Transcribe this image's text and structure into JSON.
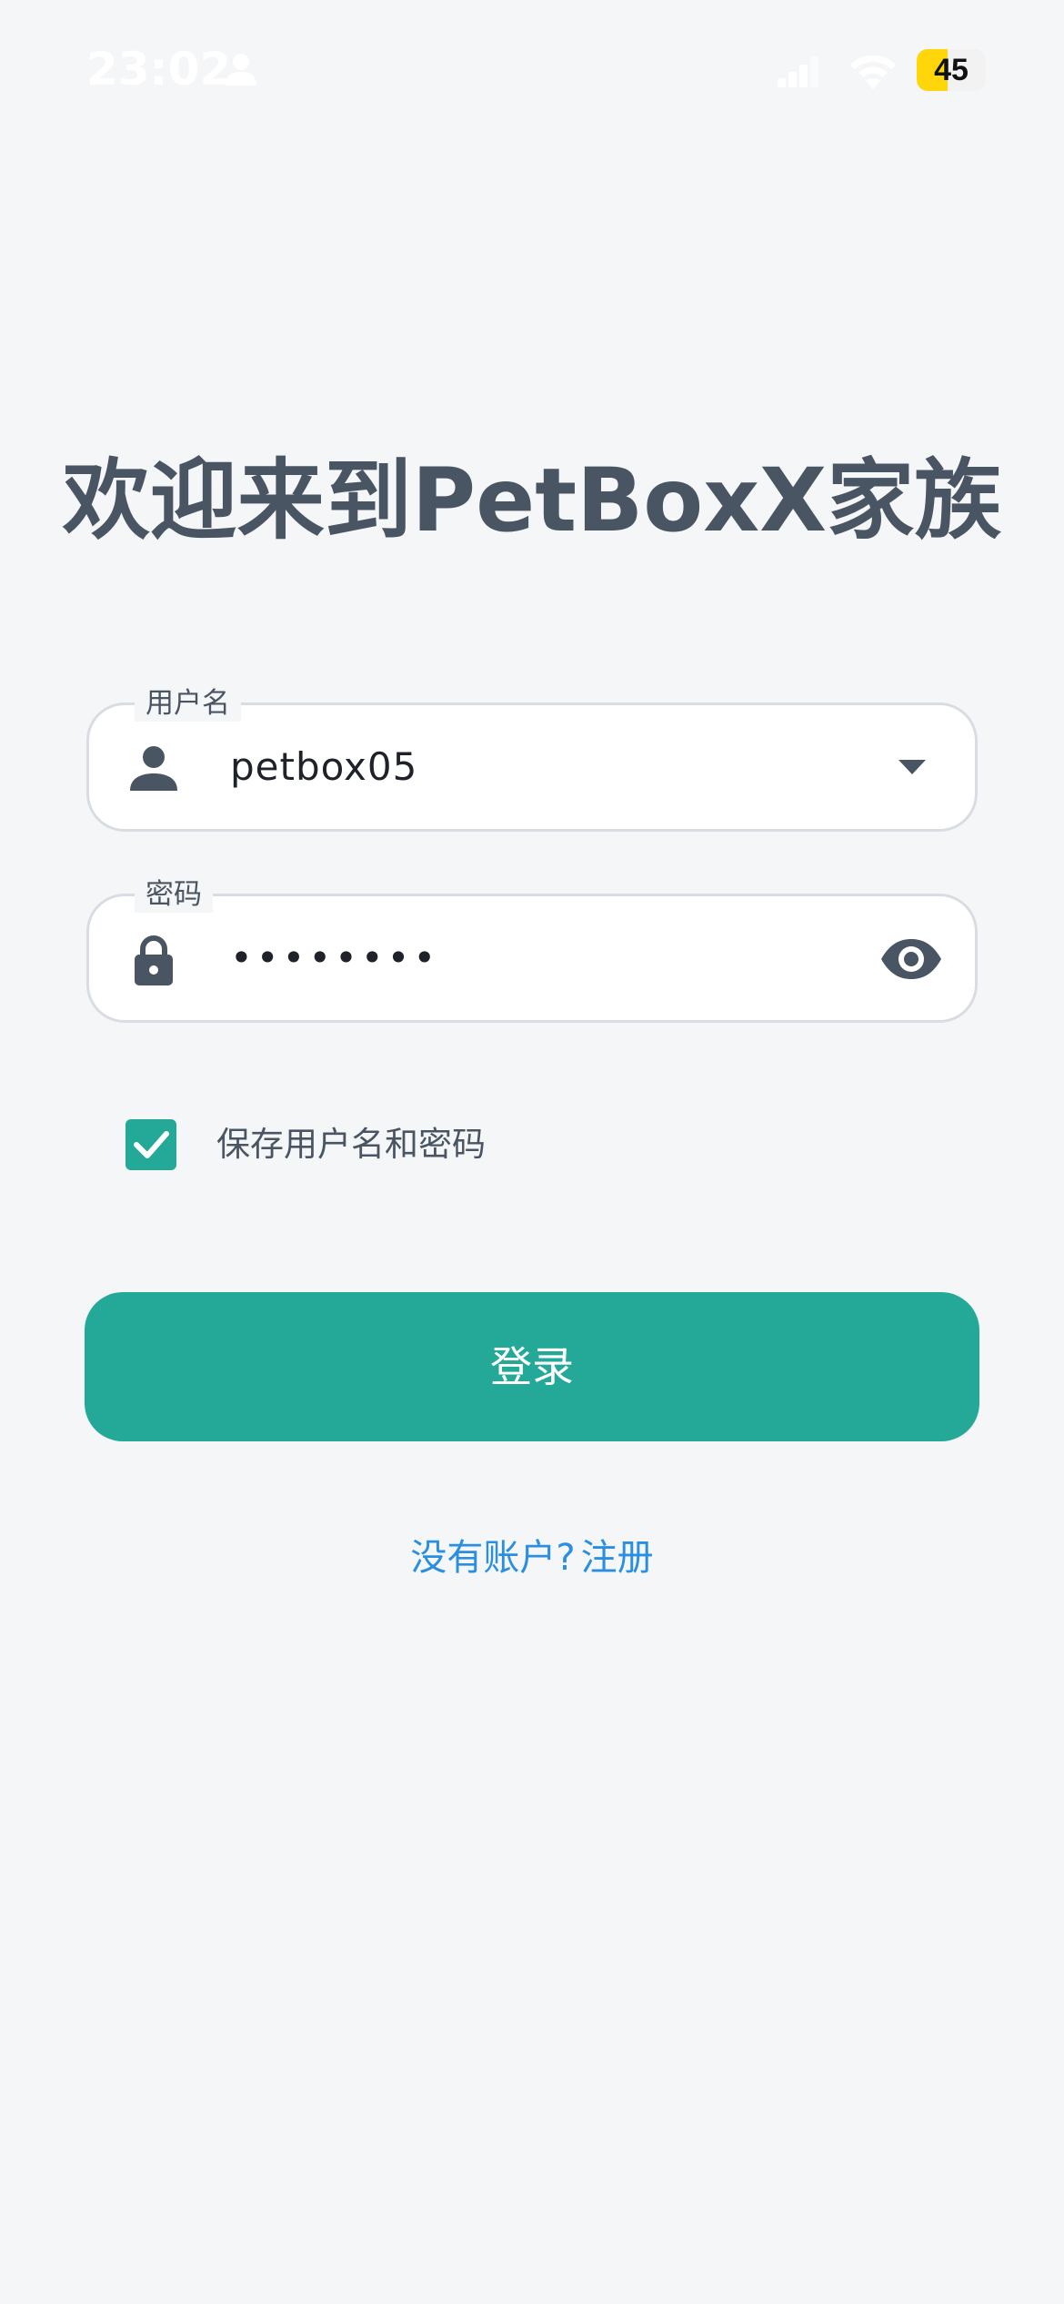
{
  "status_bar": {
    "time": "23:02",
    "battery_percent": "45",
    "battery_level": 0.45,
    "icons": [
      "person-icon",
      "cellular-signal-icon",
      "wifi-icon",
      "battery-icon"
    ]
  },
  "title": "欢迎来到PetBoxX家族",
  "username_field": {
    "label": "用户名",
    "value": "petbox05",
    "icon": "person-icon",
    "trailing_icon": "dropdown-arrow-icon"
  },
  "password_field": {
    "label": "密码",
    "value": "••••••••",
    "icon": "lock-icon",
    "trailing_icon": "eye-icon"
  },
  "remember": {
    "label": "保存用户名和密码",
    "checked": true
  },
  "login_button": {
    "label": "登录"
  },
  "register": {
    "prompt": "没有账户?",
    "link": "注册"
  },
  "colors": {
    "background": "#f5f6f8",
    "accent": "#24a898",
    "link": "#2a8fe0",
    "text": "#4a5563",
    "battery": "#ffd60a"
  }
}
